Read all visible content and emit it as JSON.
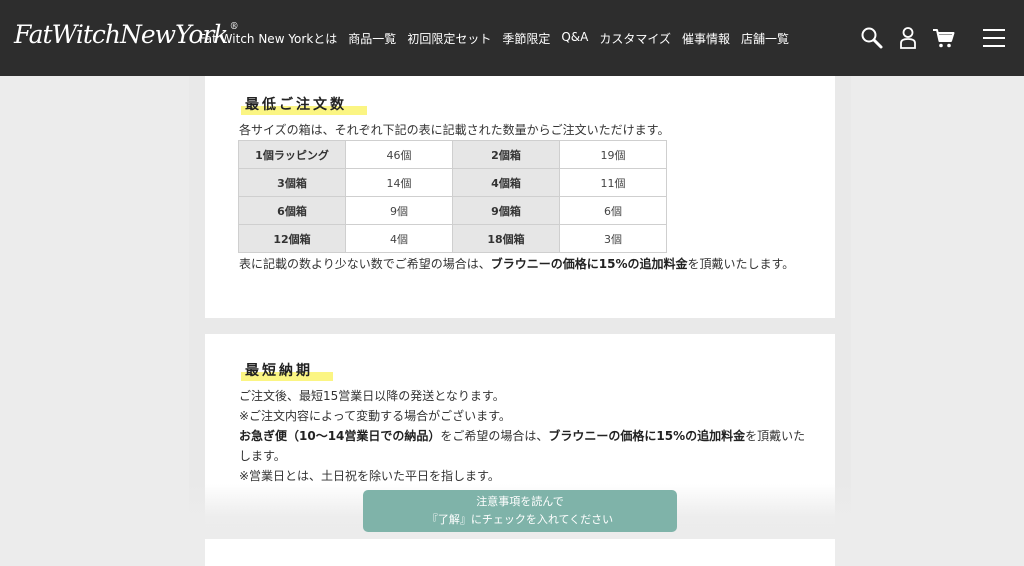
{
  "header": {
    "logo": "FatWitchNewYork",
    "logo_mark": "®",
    "nav": [
      "Fat Witch New Yorkとは",
      "商品一覧",
      "初回限定セット",
      "季節限定",
      "Q&A",
      "カスタマイズ",
      "催事情報",
      "店舗一覧"
    ],
    "icons": [
      "search-icon",
      "user-icon",
      "cart-icon",
      "menu-icon"
    ]
  },
  "min_order": {
    "title": "最低ご注文数",
    "intro": "各サイズの箱は、それぞれ下記の表に記載された数量からご注文いただけます。",
    "table": [
      [
        "1個ラッピング",
        "46個",
        "2個箱",
        "19個"
      ],
      [
        "3個箱",
        "14個",
        "4個箱",
        "11個"
      ],
      [
        "6個箱",
        "9個",
        "9個箱",
        "6個"
      ],
      [
        "12個箱",
        "4個",
        "18個箱",
        "3個"
      ]
    ],
    "note_prefix": "表に記載の数より少ない数でご希望の場合は、",
    "note_bold": "ブラウニーの価格に15%の追加料金",
    "note_suffix": "を頂戴いたします。"
  },
  "lead_time": {
    "title": "最短納期",
    "line1": "ご注文後、最短15営業日以降の発送となります。",
    "line2": "※ご注文内容によって変動する場合がございます。",
    "line3_bold": "お急ぎ便（10〜14営業日での納品）",
    "line3_mid": "をご希望の場合は、",
    "line3_bold2": "ブラウニーの価格に15%の追加料金",
    "line3_suffix": "を頂戴いたします。",
    "line4": "※営業日とは、土日祝を除いた平日を指します。"
  },
  "notice_button": {
    "line1": "注意事項を読んで",
    "line2": "『了解』にチェックを入れてください"
  },
  "colors": {
    "header_bg": "#2d2d2d",
    "highlight": "#fbf583",
    "button_bg": "#7fb3a9",
    "table_label_bg": "#e6e6e6"
  }
}
